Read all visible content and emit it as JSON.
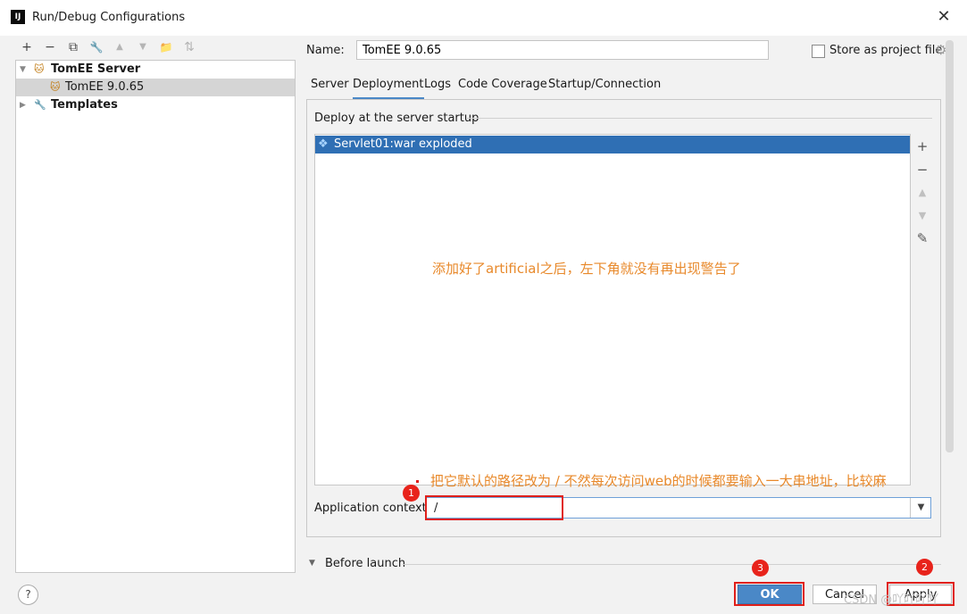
{
  "window": {
    "title": "Run/Debug Configurations",
    "app_icon": "IJ"
  },
  "toolbar": [
    {
      "icon": "plus-icon",
      "glyph": "+"
    },
    {
      "icon": "minus-icon",
      "glyph": "−"
    },
    {
      "icon": "copy-icon",
      "glyph": "⧉"
    },
    {
      "icon": "wrench-icon",
      "glyph": "🔧"
    },
    {
      "icon": "arrow-up-icon",
      "glyph": "▲"
    },
    {
      "icon": "arrow-down-icon",
      "glyph": "▼"
    },
    {
      "icon": "folder-icon",
      "glyph": "📁"
    },
    {
      "icon": "sort-icon",
      "glyph": "⇅"
    }
  ],
  "tree": {
    "server_group": "TomEE Server",
    "server_item": "TomEE 9.0.65",
    "templates": "Templates"
  },
  "form": {
    "name_label": "Name:",
    "name_value": "TomEE 9.0.65",
    "store_label": "Store as project file"
  },
  "tabs": [
    "Server",
    "Deployment",
    "Logs",
    "Code Coverage",
    "Startup/Connection"
  ],
  "deployment": {
    "section_title": "Deploy at the server startup",
    "artifact": "Servlet01:war exploded",
    "side_buttons": [
      "+",
      "−",
      "▲",
      "▼",
      "✎"
    ]
  },
  "context": {
    "label": "Application context:",
    "value": "/"
  },
  "before_launch": "Before launch",
  "buttons": {
    "help": "?",
    "ok": "OK",
    "cancel": "Cancel",
    "apply": "Apply"
  },
  "annotations": {
    "note_center": "添加好了artificial之后，左下角就没有再出现警告了",
    "note_context": "把它默认的路径改为 /   不然每次访问web的时候都要输入一大串地址，比较麻",
    "badge1": "1",
    "badge2": "2",
    "badge3": "3",
    "color": "#e8892b"
  },
  "watermark": "CSDN @吖吖吖吖"
}
